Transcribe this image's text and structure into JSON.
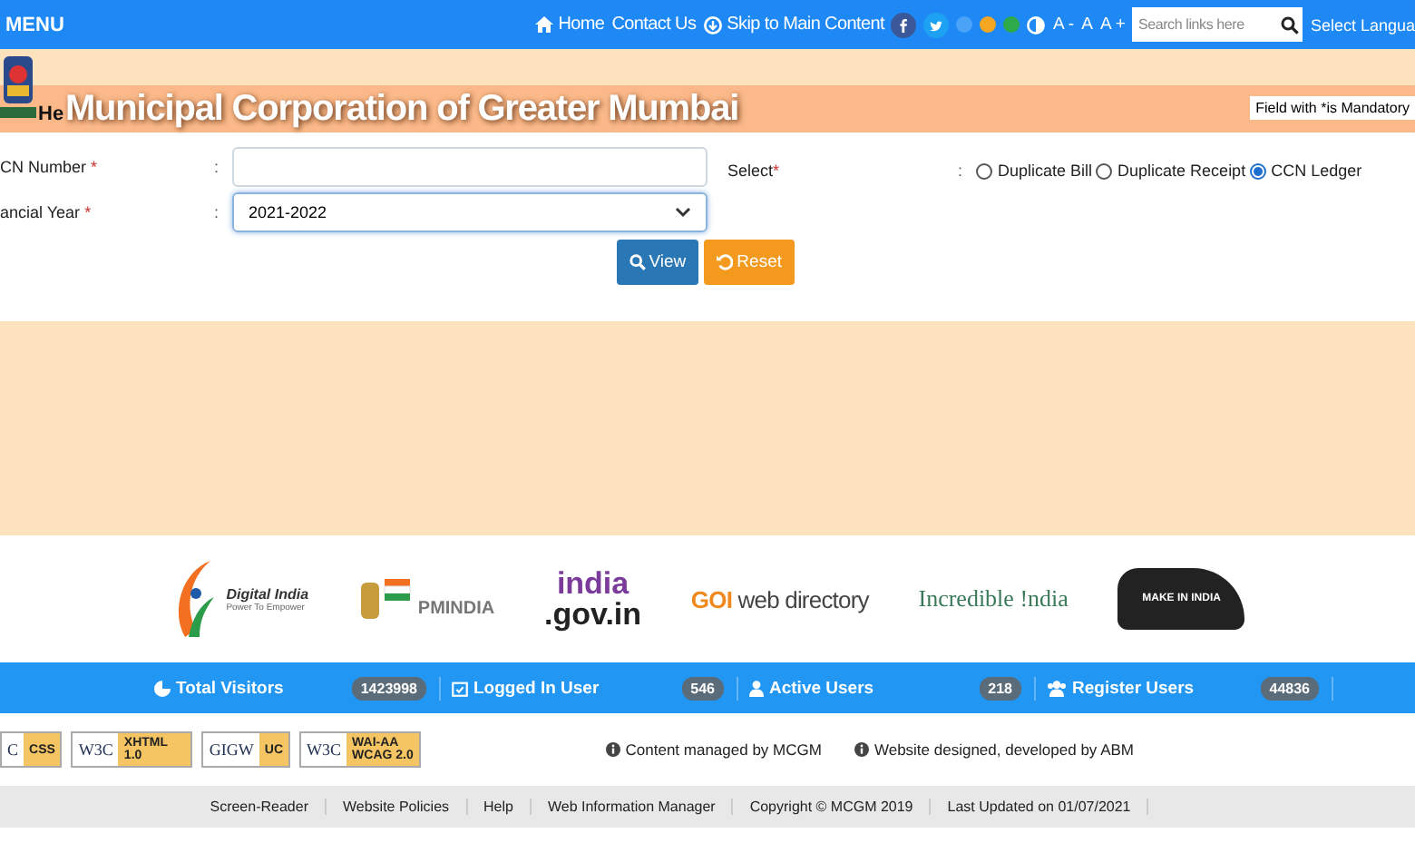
{
  "top_bar": {
    "menu": "MENU",
    "links": [
      {
        "label": "Home",
        "kind": "home"
      },
      {
        "label": "Contact Us",
        "kind": "plain"
      },
      {
        "label": "Skip to Main Content",
        "kind": "skip"
      }
    ],
    "theme_dots": [
      {
        "color": "#4aa3f7"
      },
      {
        "color": "#f5a623"
      },
      {
        "color": "#2eaa4a"
      }
    ],
    "font_sizes": [
      "A -",
      "A",
      "A +"
    ],
    "search": {
      "placeholder": "Search links here"
    },
    "language": "Select Langua"
  },
  "header": {
    "help_desk": "He",
    "title": "Municipal Corporation of Greater Mumbai",
    "mandatory_note": "Field with  *is Mandatory"
  },
  "form": {
    "fields": [
      {
        "label": "CN Number",
        "asterisk": "*",
        "colon": ":",
        "kind": "input"
      },
      {
        "label": "ancial Year",
        "asterisk": "*",
        "colon": ":",
        "kind": "select",
        "value": "2021-2022"
      }
    ],
    "select_label": "Select",
    "select_asterisk": "*",
    "select_colon": ":",
    "options": [
      {
        "label": "Duplicate Bill",
        "selected": false
      },
      {
        "label": "Duplicate Receipt",
        "selected": false
      },
      {
        "label": "CCN Ledger",
        "selected": true
      }
    ],
    "buttons": [
      {
        "label": "View",
        "kind": "view"
      },
      {
        "label": "Reset",
        "kind": "reset"
      }
    ]
  },
  "partner_logos": [
    {
      "kind": "digital",
      "title": "Digital India",
      "subtitle": "Power To Empower"
    },
    {
      "kind": "pm",
      "title": "PMINDIA"
    },
    {
      "kind": "gov",
      "title": "india",
      "subtitle": ".gov.in"
    },
    {
      "kind": "goi",
      "title": "GOI",
      "subtitle": "web directory"
    },
    {
      "kind": "incredible",
      "title": "Incredible !ndia"
    },
    {
      "kind": "make",
      "title": "MAKE IN INDIA"
    }
  ],
  "stats": [
    {
      "label": "Total Visitors",
      "count": "1423998",
      "kind": "visitors"
    },
    {
      "label": "Logged In User",
      "count": "546",
      "kind": "logged"
    },
    {
      "label": "Active Users",
      "count": "218",
      "kind": "user"
    },
    {
      "label": "Register Users",
      "count": "44836",
      "kind": "users"
    }
  ],
  "badges": [
    {
      "left": "C",
      "right": "CSS"
    },
    {
      "left": "W3C",
      "right": "XHTML 1.0"
    },
    {
      "left": "GIGW",
      "right": "UC"
    },
    {
      "left": "W3C",
      "right": "WAI-AA WCAG 2.0"
    }
  ],
  "credits": [
    "Content managed by MCGM",
    "Website designed, developed by ABM"
  ],
  "footer_links": [
    "Screen-Reader",
    "Website Policies",
    "Help",
    "Web Information Manager",
    "Copyright © MCGM 2019",
    "Last Updated on  01/07/2021"
  ]
}
